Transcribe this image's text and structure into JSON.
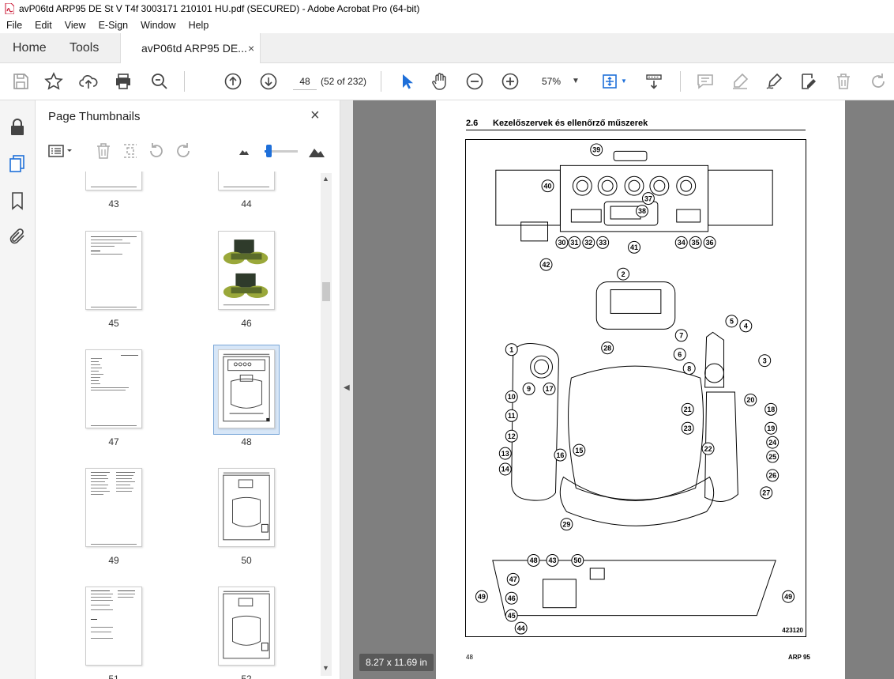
{
  "window": {
    "title": "avP06td ARP95 DE St V T4f 3003171 210101 HU.pdf (SECURED) - Adobe Acrobat Pro (64-bit)"
  },
  "menu": [
    "File",
    "Edit",
    "View",
    "E-Sign",
    "Window",
    "Help"
  ],
  "tabs": {
    "home": "Home",
    "tools": "Tools",
    "document": "avP06td ARP95 DE...",
    "close": "×"
  },
  "toolbar": {
    "page_number": "48",
    "page_count": "(52 of 232)",
    "zoom": "57%",
    "icons": [
      "save-icon",
      "star-icon",
      "upload-icon",
      "print-icon",
      "zoom-out-search-icon",
      "page-up-icon",
      "page-down-icon",
      "select-cursor-icon",
      "hand-icon",
      "zoom-minus-icon",
      "zoom-plus-icon",
      "fit-page-icon",
      "scroll-mode-icon",
      "comment-icon",
      "highlight-icon",
      "sign-icon",
      "edit-icon",
      "delete-icon",
      "rotate-icon"
    ]
  },
  "panel": {
    "title": "Page Thumbnails",
    "close": "×",
    "thumbnails": [
      {
        "label": "43"
      },
      {
        "label": "44"
      },
      {
        "label": "45"
      },
      {
        "label": "46"
      },
      {
        "label": "47"
      },
      {
        "label": "48"
      },
      {
        "label": "49"
      },
      {
        "label": "50"
      },
      {
        "label": "51"
      },
      {
        "label": "52"
      }
    ],
    "selected": "48"
  },
  "document": {
    "section_number": "2.6",
    "section_title": "Kezelőszervek és ellenőrző műszerek",
    "figure_id": "423120",
    "footer_left": "48",
    "footer_right": "ARP 95",
    "page_size": "8.27 x 11.69 in",
    "callouts": [
      "39",
      "40",
      "37",
      "38",
      "30",
      "31",
      "32",
      "33",
      "41",
      "34",
      "35",
      "36",
      "42",
      "2",
      "5",
      "4",
      "7",
      "6",
      "8",
      "3",
      "1",
      "28",
      "9",
      "17",
      "10",
      "20",
      "11",
      "21",
      "18",
      "12",
      "23",
      "19",
      "22",
      "16",
      "15",
      "24",
      "13",
      "25",
      "14",
      "26",
      "27",
      "29",
      "48",
      "43",
      "50",
      "47",
      "49",
      "46",
      "45",
      "44",
      "49"
    ]
  },
  "colors": {
    "accent_blue": "#1e6fd9",
    "doc_background": "#7f7f7f",
    "selection": "#7aa7d8"
  }
}
